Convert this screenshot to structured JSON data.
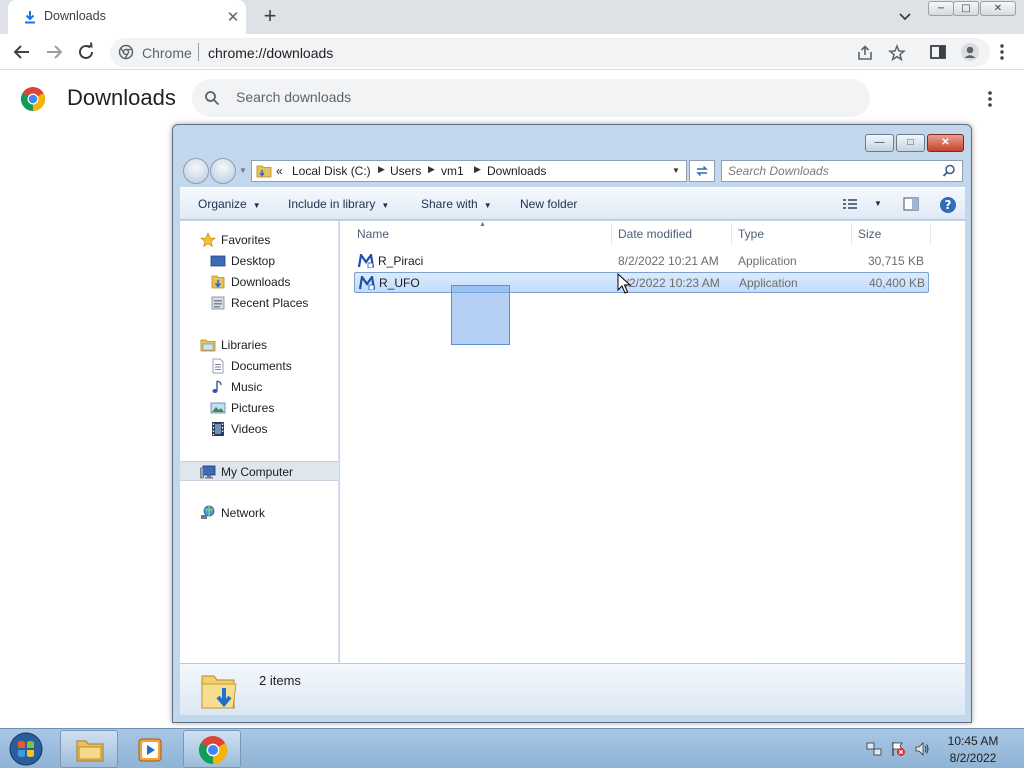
{
  "browser": {
    "tab": {
      "title": "Downloads",
      "icon": "download-icon"
    },
    "window_controls": {
      "minimize": "−",
      "maximize": "□",
      "close": "✕"
    },
    "omnibox": {
      "site": "Chrome",
      "url": "chrome://downloads"
    }
  },
  "downloads_page": {
    "title": "Downloads",
    "search_placeholder": "Search downloads"
  },
  "explorer": {
    "address": {
      "prefix": "«",
      "crumbs": [
        "Local Disk (C:)",
        "Users",
        "vm1",
        "Downloads"
      ]
    },
    "search_placeholder": "Search Downloads",
    "commands": {
      "organize": "Organize",
      "include_in_library": "Include in library",
      "share_with": "Share with",
      "new_folder": "New folder"
    },
    "nav": {
      "favorites": "Favorites",
      "desktop": "Desktop",
      "downloads": "Downloads",
      "recent_places": "Recent Places",
      "libraries": "Libraries",
      "documents": "Documents",
      "music": "Music",
      "pictures": "Pictures",
      "videos": "Videos",
      "my_computer": "My Computer",
      "network": "Network"
    },
    "columns": {
      "name": "Name",
      "date_modified": "Date modified",
      "type": "Type",
      "size": "Size"
    },
    "files": [
      {
        "name": "R_Piraci",
        "date_modified": "8/2/2022 10:21 AM",
        "type": "Application",
        "size": "30,715 KB"
      },
      {
        "name": "R_UFO",
        "date_modified": "8/2/2022 10:23 AM",
        "type": "Application",
        "size": "40,400 KB"
      }
    ],
    "item_count": "2 items"
  },
  "taskbar": {
    "time": "10:45 AM",
    "date": "8/2/2022"
  },
  "colors": {
    "chrome_tabstrip": "#dee1e6",
    "explorer_frame": "#c2d7ec",
    "selection": "#cce8ff",
    "taskbar": "#9bbddf"
  }
}
